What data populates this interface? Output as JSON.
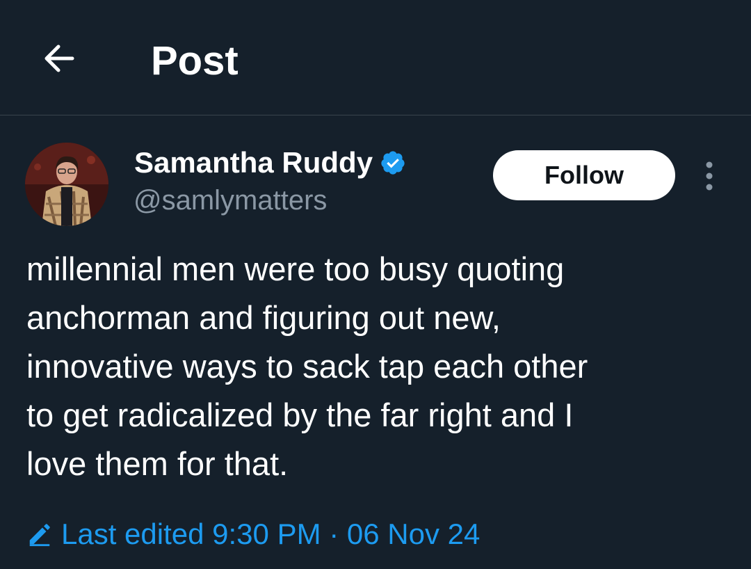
{
  "header": {
    "title": "Post",
    "back_icon": "arrow-left-icon"
  },
  "post": {
    "author": {
      "name": "Samantha Ruddy",
      "handle": "@samlymatters",
      "verified_icon": "verified-badge-icon",
      "verified_color": "#1d9bf0"
    },
    "follow_label": "Follow",
    "more_icon": "more-vertical-icon",
    "text_lines": [
      "millennial men were too busy quoting",
      "anchorman and figuring out new,",
      "innovative ways to sack tap each other",
      "to get radicalized by the far right and I",
      "love them for that."
    ],
    "edit_icon": "pencil-icon",
    "edited_label": "Last edited 9:30 PM · 06 Nov 24"
  },
  "colors": {
    "background": "#15202b",
    "accent": "#1d9bf0",
    "secondary_text": "#8b98a5",
    "divider": "#38444d"
  }
}
